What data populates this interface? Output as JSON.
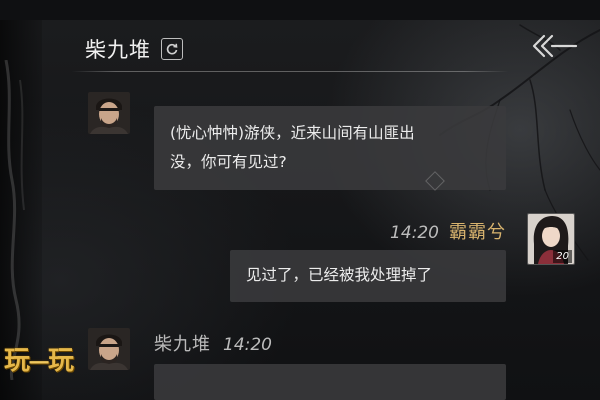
{
  "header": {
    "npc_name": "柴九堆",
    "refresh_icon": "refresh-icon",
    "back_icon": "back-arrow-icon"
  },
  "messages": [
    {
      "sender": "柴九堆",
      "side": "left",
      "line1": "(忧心忡忡)游侠，近来山间有山匪出",
      "line2": "没，你可有见过?"
    },
    {
      "sender": "霸霸兮",
      "side": "right",
      "time": "14:20",
      "level": "20",
      "text": "见过了，已经被我处理掉了"
    },
    {
      "sender": "柴九堆",
      "side": "left",
      "time": "14:20",
      "text": ""
    }
  ],
  "watermark": {
    "left": "玩",
    "middle": "一",
    "right": "玩"
  },
  "colors": {
    "player_name": "#d9b46e",
    "bubble": "#3a3a3c",
    "watermark": "#e6b84a"
  }
}
